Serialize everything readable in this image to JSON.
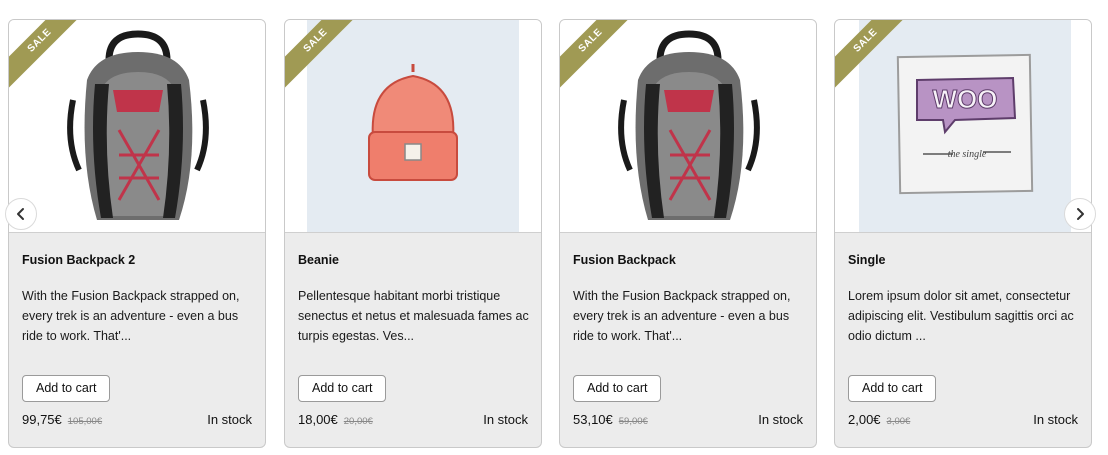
{
  "carousel": {
    "prev_icon": "chevron-left-icon",
    "next_icon": "chevron-right-icon"
  },
  "badge_color": "#a09a54",
  "products": [
    {
      "badge": "SALE",
      "title": "Fusion Backpack 2",
      "description": "With the Fusion Backpack strapped on, every trek is an adventure - even a bus ride to work. That'...",
      "button": "Add to cart",
      "price": "99,75€",
      "old_price": "105,00€",
      "stock": "In stock",
      "image": "backpack"
    },
    {
      "badge": "SALE",
      "title": "Beanie",
      "description": "Pellentesque habitant morbi tristique senectus et netus et malesuada fames ac turpis egestas. Ves...",
      "button": "Add to cart",
      "price": "18,00€",
      "old_price": "20,00€",
      "stock": "In stock",
      "image": "beanie"
    },
    {
      "badge": "SALE",
      "title": "Fusion Backpack",
      "description": "With the Fusion Backpack strapped on, every trek is an adventure - even a bus ride to work. That'...",
      "button": "Add to cart",
      "price": "53,10€",
      "old_price": "59,00€",
      "stock": "In stock",
      "image": "backpack"
    },
    {
      "badge": "SALE",
      "title": "Single",
      "description": "Lorem ipsum dolor sit amet, consectetur adipiscing elit. Vestibulum sagittis orci ac odio dictum ...",
      "button": "Add to cart",
      "price": "2,00€",
      "old_price": "3,00€",
      "stock": "In stock",
      "image": "woo-single",
      "image_text": "WOO",
      "image_caption": "the single"
    }
  ]
}
